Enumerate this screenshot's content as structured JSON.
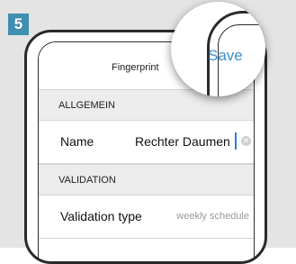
{
  "step": {
    "number": "5"
  },
  "nav": {
    "title": "Fingerprint",
    "save_label": "Save"
  },
  "sections": {
    "general": "ALLGEMEIN",
    "validation": "VALIDATION"
  },
  "fields": {
    "name": {
      "label": "Name",
      "value": "Rechter Daumen"
    },
    "validation_type": {
      "label": "Validation type",
      "value": "weekly schedule"
    }
  },
  "colors": {
    "badge": "#3f8fb0",
    "accent": "#3a8fd0",
    "cursor": "#2a7fd9",
    "section_bg": "#ececec"
  },
  "icons": {
    "clear": "clear-circle-icon"
  }
}
